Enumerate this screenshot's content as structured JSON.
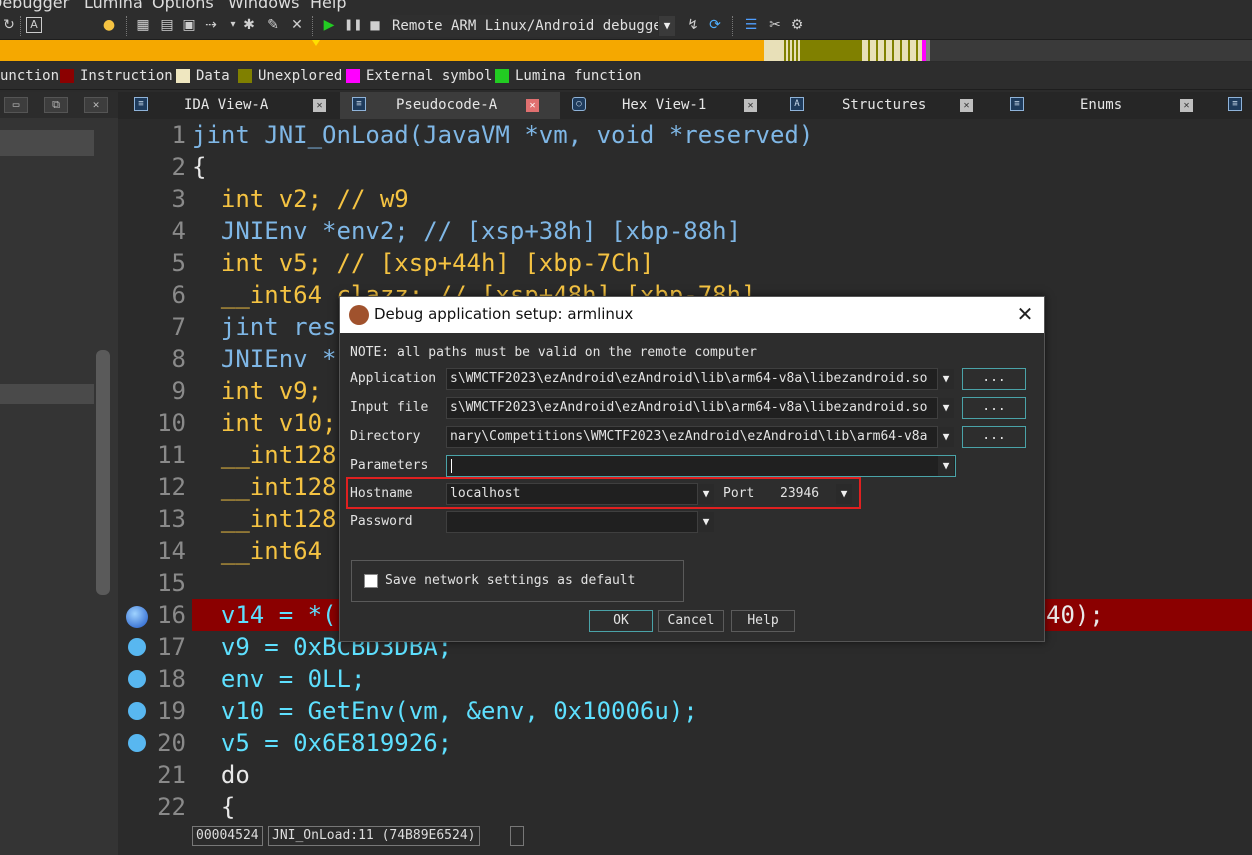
{
  "menubar": {
    "items": [
      "Debugger",
      "Lumina",
      "Options",
      "Windows",
      "Help"
    ]
  },
  "toolbar": {
    "debugger_select": "Remote ARM Linux/Android debugger"
  },
  "legend": [
    {
      "label": "unction",
      "color": ""
    },
    {
      "label": "Instruction",
      "color": "#8b0000"
    },
    {
      "label": "Data",
      "color": "#efe7c0"
    },
    {
      "label": "Unexplored",
      "color": "#808000"
    },
    {
      "label": "External symbol",
      "color": "#ff00ff"
    },
    {
      "label": "Lumina function",
      "color": "#22cc22"
    }
  ],
  "tabs": [
    {
      "label": "IDA View-A",
      "icon": "disasm-icon"
    },
    {
      "label": "Pseudocode-A",
      "icon": "pseudocode-icon"
    },
    {
      "label": "Hex View-1",
      "icon": "hex-icon"
    },
    {
      "label": "Structures",
      "icon": "struct-icon"
    },
    {
      "label": "Enums",
      "icon": "enum-icon"
    }
  ],
  "code": {
    "lines": [
      {
        "n": "1",
        "text": "jint JNI_OnLoad(JavaVM *vm, void *reserved)"
      },
      {
        "n": "2",
        "text": "{"
      },
      {
        "n": "3",
        "text": "  int v2; // w9"
      },
      {
        "n": "4",
        "text": "  JNIEnv *env2; // [xsp+38h] [xbp-88h]"
      },
      {
        "n": "5",
        "text": "  int v5; // [xsp+44h] [xbp-7Ch]"
      },
      {
        "n": "6",
        "text": "  __int64 clazz; // [xsp+48h] [xbp-78h]"
      },
      {
        "n": "7",
        "text": "  jint res"
      },
      {
        "n": "8",
        "text": "  JNIEnv *"
      },
      {
        "n": "9",
        "text": "  int v9;"
      },
      {
        "n": "10",
        "text": "  int v10;"
      },
      {
        "n": "11",
        "text": "  __int128"
      },
      {
        "n": "12",
        "text": "  __int128"
      },
      {
        "n": "13",
        "text": "  __int128"
      },
      {
        "n": "14",
        "text": "  __int64"
      },
      {
        "n": "15",
        "text": ""
      },
      {
        "n": "16",
        "text": "  v14 = *(",
        "tail": "40);"
      },
      {
        "n": "17",
        "text": "  v9 = 0xBCBD3DBA;"
      },
      {
        "n": "18",
        "text": "  env = 0LL;"
      },
      {
        "n": "19",
        "text": "  v10 = GetEnv(vm, &env, 0x10006u);"
      },
      {
        "n": "20",
        "text": "  v5 = 0x6E819926;"
      },
      {
        "n": "21",
        "text": "  do"
      },
      {
        "n": "22",
        "text": "  {"
      }
    ]
  },
  "status": {
    "address": "00004524",
    "location": "JNI_OnLoad:11 (74B89E6524)"
  },
  "dialog": {
    "title": "Debug application setup: armlinux",
    "note": "NOTE: all paths must be valid on the remote computer",
    "application_label": "Application",
    "application_value": "s\\WMCTF2023\\ezAndroid\\ezAndroid\\lib\\arm64-v8a\\libezandroid.so",
    "input_file_label": "Input file",
    "input_file_value": "s\\WMCTF2023\\ezAndroid\\ezAndroid\\lib\\arm64-v8a\\libezandroid.so",
    "directory_label": "Directory",
    "directory_value": "nary\\Competitions\\WMCTF2023\\ezAndroid\\ezAndroid\\lib\\arm64-v8a",
    "parameters_label": "Parameters",
    "parameters_value": "",
    "hostname_label": "Hostname",
    "hostname_value": "localhost",
    "port_label": "Port",
    "port_value": "23946",
    "password_label": "Password",
    "password_value": "",
    "browse_label": "...",
    "save_default_label": "Save network settings as default",
    "save_default_checked": false,
    "ok_label": "OK",
    "cancel_label": "Cancel",
    "help_label": "Help"
  }
}
